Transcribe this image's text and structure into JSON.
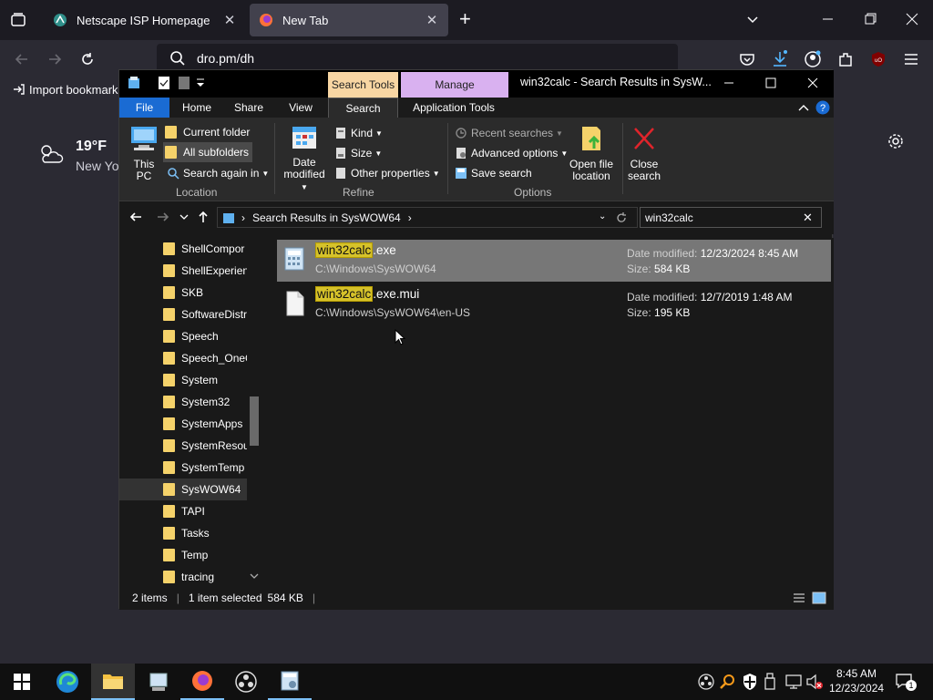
{
  "browser": {
    "tabs": [
      {
        "label": "Netscape ISP Homepage",
        "active": false
      },
      {
        "label": "New Tab",
        "active": true
      }
    ],
    "url": "dro.pm/dh",
    "bookmarks": {
      "import_label": "Import bookmarks"
    },
    "weather": {
      "temp": "19°F",
      "city": "New Yo"
    }
  },
  "explorer": {
    "context_tabs": {
      "search_tools": "Search Tools",
      "manage": "Manage"
    },
    "title": "win32calc - Search Results in SysW...",
    "ribbon_tabs": [
      "File",
      "Home",
      "Share",
      "View",
      "Search",
      "Application Tools"
    ],
    "location": {
      "this_pc": "This PC",
      "current_folder": "Current folder",
      "all_subfolders": "All subfolders",
      "search_again": "Search again in",
      "group": "Location"
    },
    "refine": {
      "date_modified": "Date modified",
      "kind": "Kind",
      "size": "Size",
      "other_properties": "Other properties",
      "group": "Refine"
    },
    "options": {
      "recent_searches": "Recent searches",
      "advanced_options": "Advanced options",
      "save_search": "Save search",
      "open_file_location": "Open file location",
      "close_search": "Close search",
      "group": "Options"
    },
    "address": {
      "path": "Search Results in SysWOW64",
      "search_query": "win32calc"
    },
    "nav_items": [
      "ShellCompor",
      "ShellExperien",
      "SKB",
      "SoftwareDistr",
      "Speech",
      "Speech_OneC",
      "System",
      "System32",
      "SystemApps",
      "SystemResou",
      "SystemTemp",
      "SysWOW64",
      "TAPI",
      "Tasks",
      "Temp",
      "tracing"
    ],
    "nav_selected": "SysWOW64",
    "results": [
      {
        "highlight": "win32calc",
        "rest": ".exe",
        "path": "C:\\Windows\\SysWOW64",
        "date_label": "Date modified:",
        "date": "12/23/2024 8:45 AM",
        "size_label": "Size:",
        "size": "584 KB",
        "selected": true
      },
      {
        "highlight": "win32calc",
        "rest": ".exe.mui",
        "path": "C:\\Windows\\SysWOW64\\en-US",
        "date_label": "Date modified:",
        "date": "12/7/2019 1:48 AM",
        "size_label": "Size:",
        "size": "195 KB",
        "selected": false
      }
    ],
    "status": {
      "items": "2 items",
      "selected": "1 item selected",
      "size": "584 KB"
    }
  },
  "taskbar": {
    "time": "8:45 AM",
    "date": "12/23/2024",
    "notification_count": "1"
  }
}
